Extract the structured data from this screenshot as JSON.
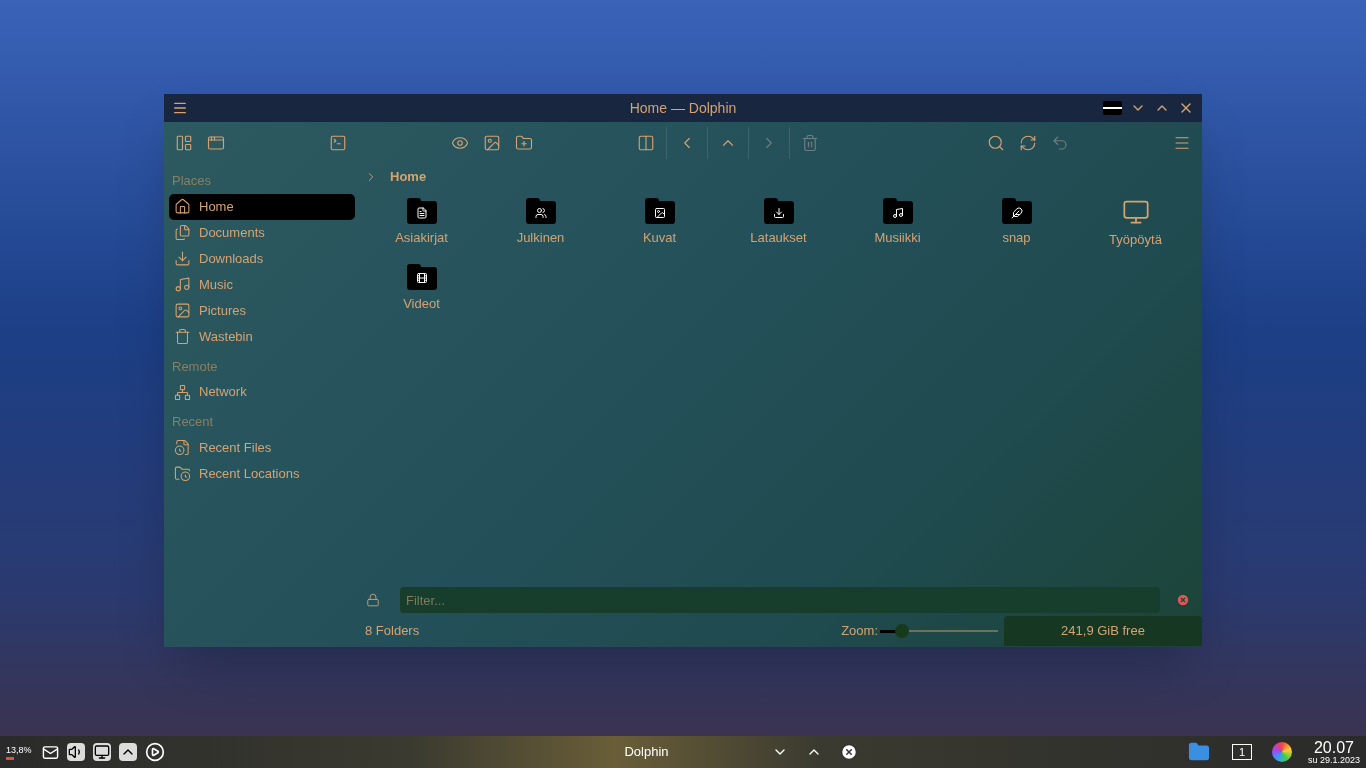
{
  "window": {
    "title": "Home — Dolphin"
  },
  "sidebar": {
    "sections": [
      {
        "heading": "Places",
        "items": [
          {
            "label": "Home",
            "kind": "home",
            "selected": true
          },
          {
            "label": "Documents",
            "kind": "documents",
            "selected": false
          },
          {
            "label": "Downloads",
            "kind": "downloads",
            "selected": false
          },
          {
            "label": "Music",
            "kind": "music",
            "selected": false
          },
          {
            "label": "Pictures",
            "kind": "pictures",
            "selected": false
          },
          {
            "label": "Wastebin",
            "kind": "trash",
            "selected": false
          }
        ]
      },
      {
        "heading": "Remote",
        "items": [
          {
            "label": "Network",
            "kind": "network",
            "selected": false
          }
        ]
      },
      {
        "heading": "Recent",
        "items": [
          {
            "label": "Recent Files",
            "kind": "recent-files",
            "selected": false
          },
          {
            "label": "Recent Locations",
            "kind": "recent-locations",
            "selected": false
          }
        ]
      }
    ]
  },
  "breadcrumb": {
    "location": "Home"
  },
  "files": [
    {
      "name": "Asiakirjat",
      "kind": "documents"
    },
    {
      "name": "Julkinen",
      "kind": "public"
    },
    {
      "name": "Kuvat",
      "kind": "pictures"
    },
    {
      "name": "Lataukset",
      "kind": "downloads"
    },
    {
      "name": "Musiikki",
      "kind": "music"
    },
    {
      "name": "snap",
      "kind": "snap"
    },
    {
      "name": "Työpöytä",
      "kind": "desktop"
    },
    {
      "name": "Videot",
      "kind": "videos"
    }
  ],
  "filter": {
    "placeholder": "Filter..."
  },
  "status_bar": {
    "summary": "8 Folders",
    "zoom_label": "Zoom:",
    "zoom": {
      "level": 0.19
    },
    "free_space": "241,9 GiB free"
  },
  "taskbar": {
    "cpu": "13,8%",
    "task": "Dolphin",
    "pager": "1",
    "time": "20.07",
    "date": "su 29.1.2023"
  }
}
